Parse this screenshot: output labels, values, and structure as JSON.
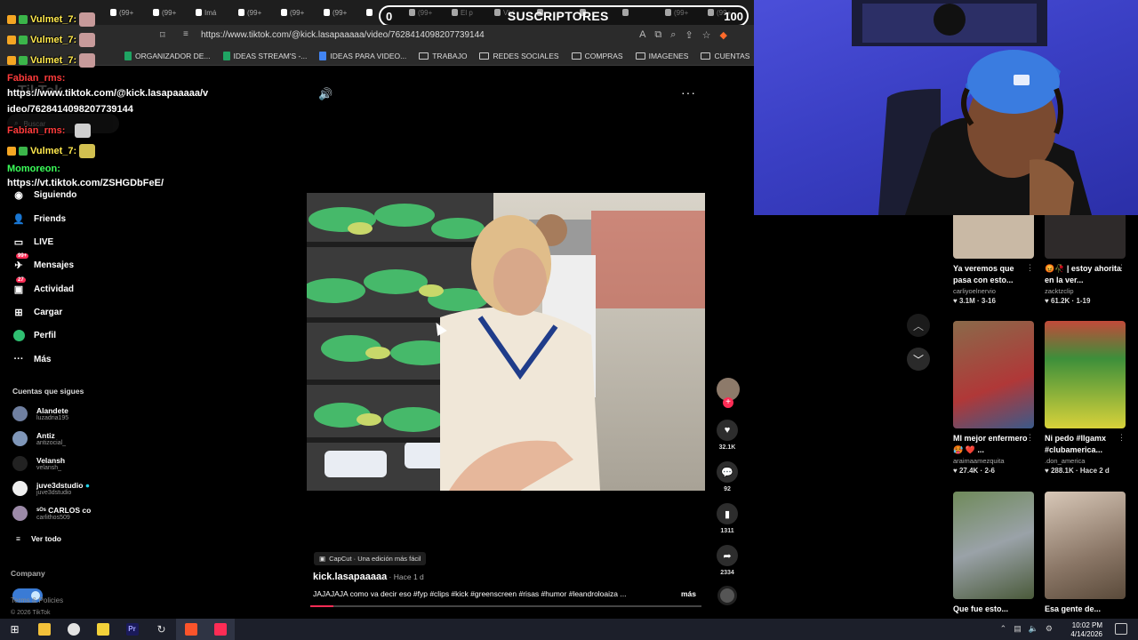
{
  "browser": {
    "tab_labels": [
      "(99+",
      "(99+",
      "Imá",
      "(99+",
      "(99+",
      "(99+",
      "",
      "(99+",
      "El p",
      "Vivi",
      "",
      "",
      "",
      "(99+",
      "(99+",
      ""
    ],
    "url": "https://www.tiktok.com/@kick.lasapaaaaa/video/7628414098207739144",
    "bookmarks": [
      {
        "icon": "google-sheets-icon",
        "label": "ORGANIZADOR DE..."
      },
      {
        "icon": "google-sheets-icon",
        "label": "IDEAS STREAM'S -..."
      },
      {
        "icon": "google-docs-icon",
        "label": "IDEAS PARA VIDEO..."
      },
      {
        "icon": "folder-icon",
        "label": "TRABAJO"
      },
      {
        "icon": "folder-icon",
        "label": "REDES SOCIALES"
      },
      {
        "icon": "folder-icon",
        "label": "COMPRAS"
      },
      {
        "icon": "folder-icon",
        "label": "IMAGENES"
      },
      {
        "icon": "folder-icon",
        "label": "CUENTAS"
      },
      {
        "icon": "folder-icon",
        "label": "IA"
      }
    ]
  },
  "subs_bar": {
    "current": "0",
    "label": "SUSCRIPTORES",
    "goal": "100"
  },
  "chat": [
    {
      "user": "Vulmet_7:",
      "user_color": "#ffe94d",
      "text": "",
      "emote": "emote-pink"
    },
    {
      "user": "Vulmet_7:",
      "user_color": "#ffe94d",
      "text": "",
      "emote": "emote-pink"
    },
    {
      "user": "Vulmet_7:",
      "user_color": "#ffe94d",
      "text": "",
      "emote": "emote-pink"
    },
    {
      "user": "Fabian_rms:",
      "user_color": "#ff3b3b",
      "text": "",
      "emote": ""
    },
    {
      "user": "",
      "user_color": "",
      "text": "https://www.tiktok.com/@kick.lasapaaaaa/v",
      "emote": ""
    },
    {
      "user": "",
      "user_color": "",
      "text": "ideo/7628414098207739144",
      "emote": ""
    },
    {
      "user": "Fabian_rms:",
      "user_color": "#ff3b3b",
      "text": "",
      "emote": "emote-white"
    },
    {
      "user": "Vulmet_7:",
      "user_color": "#ffe94d",
      "text": "",
      "emote": "emote-yellow"
    },
    {
      "user": "Momoreon:",
      "user_color": "#3bff5a",
      "text": "",
      "emote": ""
    },
    {
      "user": "",
      "user_color": "",
      "text": "https://vt.tiktok.com/ZSHGDbFeE/",
      "emote": ""
    }
  ],
  "tiktok_nav": {
    "logo": "TikTok",
    "search_placeholder": "Buscar",
    "items": [
      {
        "label": "Siguiendo",
        "icon": "following-icon",
        "badge": ""
      },
      {
        "label": "Friends",
        "icon": "friends-icon",
        "badge": ""
      },
      {
        "label": "LIVE",
        "icon": "live-icon",
        "badge": ""
      },
      {
        "label": "Mensajes",
        "icon": "messages-icon",
        "badge": "99+"
      },
      {
        "label": "Actividad",
        "icon": "activity-icon",
        "badge": "27"
      },
      {
        "label": "Cargar",
        "icon": "upload-icon",
        "badge": ""
      },
      {
        "label": "Perfil",
        "icon": "profile-icon",
        "badge": ""
      },
      {
        "label": "Más",
        "icon": "more-icon",
        "badge": ""
      }
    ],
    "following_header": "Cuentas que sigues",
    "accounts": [
      {
        "name": "Alandete",
        "handle": "luzadria195"
      },
      {
        "name": "Antiz",
        "handle": "antizocial_"
      },
      {
        "name": "Velansh",
        "handle": "velansh_"
      },
      {
        "name": "juve3dstudio",
        "handle": "juve3dstudio"
      },
      {
        "name": "ˢᴼˢ CARLOS co",
        "handle": "carlithos509"
      }
    ],
    "see_all": "Ver todo",
    "company": "Company",
    "policies": "Terms & Policies",
    "copyright": "© 2026 TikTok"
  },
  "video": {
    "capcut": "CapCut · Una edición más fácil",
    "author": "kick.lasapaaaaa",
    "ago": " · Hace 1 d",
    "caption": "JAJAJAJA como va decir eso #fyp #clips #kick #greenscreen #risas #humor #leandroloaiza ...",
    "more": "más",
    "progress": 0.06,
    "likes": "32.1K",
    "comments": "92",
    "saves": "1311",
    "shares": "2334"
  },
  "grid": [
    {
      "title": "Ya veremos que pasa con esto...",
      "user": "carliyoelnervio",
      "stats": "3.1M · 3-16",
      "thumb": "#c9b9a5"
    },
    {
      "title": "😡🥀 | estoy ahorita en la ver...",
      "user": "zacktzclip",
      "stats": "61.2K · 1-19",
      "thumb": "#2e2a2a"
    },
    {
      "title": "MI mejor enfermero🥵 ❤️ ...",
      "user": "araimaamezquita",
      "stats": "27.4K · 2-6",
      "thumb": "#b03838"
    },
    {
      "title": "Ni pedo #llgamx #clubamerica...",
      "user": ".don_america",
      "stats": "288.1K · Hace 2 d",
      "thumb": "#3d8f3a"
    },
    {
      "title": "Que fue esto...",
      "user": "",
      "stats": "",
      "thumb": "#5c6b4f"
    },
    {
      "title": "Esa gente de...",
      "user": "",
      "stats": "",
      "thumb": "#8a7666"
    }
  ],
  "taskbar": {
    "time": "10:02 PM",
    "date": "4/14/2026",
    "apps": [
      "windows-icon",
      "file-explorer-icon",
      "chrome-icon",
      "sticky-icon",
      "premiere-icon",
      "app-icon",
      "brave-icon",
      "tiktok-icon"
    ]
  }
}
